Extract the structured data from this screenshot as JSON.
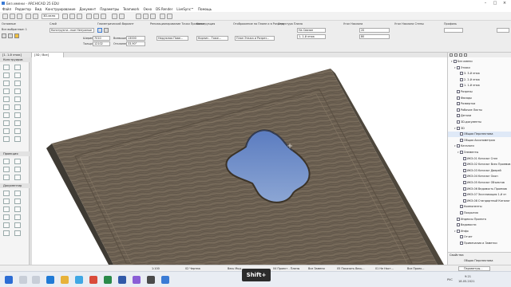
{
  "window": {
    "title": "Без имени - ARCHICAD 25 EDU"
  },
  "menu": [
    "Файл",
    "Редактор",
    "Вид",
    "Конструирование",
    "Документ",
    "Параметры",
    "Teamwork",
    "Окно",
    "DS Render",
    "LiveSync™",
    "Помощь"
  ],
  "toolbar": {
    "view_3d": "3D-окно"
  },
  "infobox": {
    "fields": [
      {
        "label": "Основные",
        "value": ""
      },
      {
        "label": "Все выбранные: 1",
        "value": ""
      },
      {
        "label": "Слой",
        "value": "Конструкти...ные Ненужные"
      },
      {
        "label": "Геометрический Вариант",
        "value": ""
      },
      {
        "label": "Ширина",
        "value": "7010"
      },
      {
        "label": "Толщина",
        "value": "12102"
      },
      {
        "label": "Возвышение",
        "value": "13000"
      },
      {
        "label": "Отклонение",
        "value": "33,90°"
      },
      {
        "label": "Репозиционирование Точки Привязки",
        "value": "Наружная Пове..."
      },
      {
        "label": "Конструкция",
        "value": "Кирпич - Тяже..."
      },
      {
        "label": "Отображение на Плане и в Разрезе",
        "value": "План Этажа и Разрез..."
      },
      {
        "label": "Структура Плана",
        "value": "1. 1-й этаж"
      },
      {
        "label": "Покрытия",
        "value": ""
      },
      {
        "label": "Описание",
        "value": ""
      },
      {
        "label": "Связанный Этаж",
        "value": "На Связан"
      },
      {
        "label": "Угол Наклона",
        "value": "20"
      },
      {
        "label": "Угол Наклона Стены",
        "value": "80"
      },
      {
        "label": "Основная Стена",
        "value": "1. 1-й этаж"
      },
      {
        "label": "Профиль",
        "value": "Все"
      }
    ]
  },
  "tabs": [
    {
      "label": "[1. 1-й этаж]",
      "active": false
    },
    {
      "label": "[3D / Все]",
      "active": true
    }
  ],
  "toolbox": {
    "sections": [
      "Конструиров",
      "Проекция",
      "Документир"
    ]
  },
  "navigator": {
    "items": [
      {
        "label": "Без имени",
        "indent": 1,
        "icon": "project-icon",
        "expanded": true
      },
      {
        "label": "Этажи",
        "indent": 2,
        "icon": "stories-icon",
        "expanded": true
      },
      {
        "label": "3. 3-й этаж",
        "indent": 3,
        "icon": "story-icon"
      },
      {
        "label": "2. 2-й этаж",
        "indent": 3,
        "icon": "story-icon"
      },
      {
        "label": "1. 1-й этаж",
        "indent": 3,
        "icon": "story-icon"
      },
      {
        "label": "Разрезы",
        "indent": 2,
        "icon": "section-icon"
      },
      {
        "label": "Фасады",
        "indent": 2,
        "icon": "elevation-icon"
      },
      {
        "label": "Развертки",
        "indent": 2,
        "icon": "interior-elevation-icon"
      },
      {
        "label": "Рабочие Листы",
        "indent": 2,
        "icon": "worksheet-icon"
      },
      {
        "label": "Детали",
        "indent": 2,
        "icon": "detail-icon"
      },
      {
        "label": "3D-документы",
        "indent": 2,
        "icon": "3d-document-icon"
      },
      {
        "label": "3D",
        "indent": 2,
        "icon": "3d-icon",
        "expanded": true
      },
      {
        "label": "Общая Перспектива",
        "indent": 3,
        "icon": "perspective-icon",
        "selected": true
      },
      {
        "label": "Общая Аксонометрия",
        "indent": 3,
        "icon": "axonometry-icon"
      },
      {
        "label": "Каталоги",
        "indent": 2,
        "icon": "schedule-icon",
        "expanded": true
      },
      {
        "label": "Элементы",
        "indent": 3,
        "icon": "folder-icon",
        "expanded": true
      },
      {
        "label": "ИКЭ-01 Каталог Стен",
        "indent": 4,
        "icon": "list-icon"
      },
      {
        "label": "ИКЭ-02 Каталог Всех Проемов",
        "indent": 4,
        "icon": "list-icon"
      },
      {
        "label": "ИКЭ-03 Каталог Дверей",
        "indent": 4,
        "icon": "list-icon"
      },
      {
        "label": "ИКЭ-04 Каталог Окон",
        "indent": 4,
        "icon": "list-icon"
      },
      {
        "label": "ИКЭ-05 Каталог Объектов",
        "indent": 4,
        "icon": "list-icon"
      },
      {
        "label": "ИКЭ-06 Ведомость Проемов",
        "indent": 4,
        "icon": "list-icon"
      },
      {
        "label": "ИКЭ-07 Экспликация 1-й эт",
        "indent": 4,
        "icon": "list-icon"
      },
      {
        "label": "ИКЭ-08 Стандартный Каталог",
        "indent": 4,
        "icon": "list-icon"
      },
      {
        "label": "Компоненты",
        "indent": 3,
        "icon": "folder-icon"
      },
      {
        "label": "Покрытия",
        "indent": 3,
        "icon": "folder-icon"
      },
      {
        "label": "Индексы Проекта",
        "indent": 2,
        "icon": "index-icon"
      },
      {
        "label": "Ведомости",
        "indent": 2,
        "icon": "list-icon"
      },
      {
        "label": "Инфо",
        "indent": 2,
        "icon": "info-icon",
        "expanded": true
      },
      {
        "label": "Отчет",
        "indent": 3,
        "icon": "report-icon"
      },
      {
        "label": "Примечания и Заметки",
        "indent": 3,
        "icon": "notes-icon"
      }
    ]
  },
  "properties": {
    "header": "Свойства",
    "view_name": "Общая Перспектива",
    "button": "Параметры..."
  },
  "status": [
    "1:100",
    "02 Чертеж",
    "Весь Мод...",
    "04 Проект - Планы",
    "Все Замени",
    "05 Показать Весь...",
    "01 Не Наст...",
    "Все Проек..."
  ],
  "taskbar": {
    "time": "9:21",
    "date": "18.05.2021",
    "lang": "РУС",
    "key_overlay": "Shift+"
  },
  "colors": {
    "accent": "#3a7bd5",
    "wood": "#6d6051",
    "water": "#7594c8"
  }
}
